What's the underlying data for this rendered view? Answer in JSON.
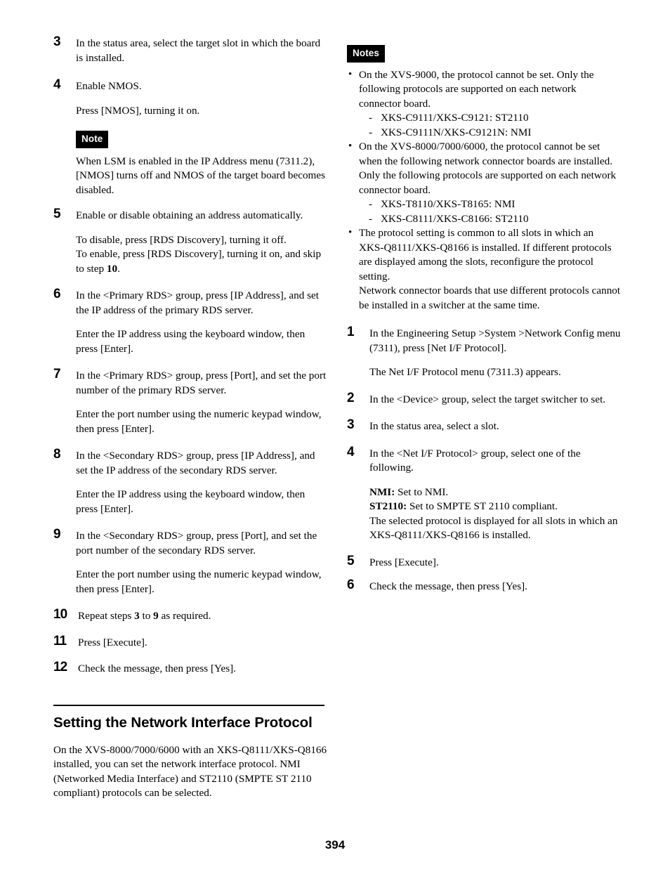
{
  "page": {
    "number": "394"
  },
  "left_column": {
    "steps": [
      {
        "num": "3",
        "paragraphs": [
          "In the status area, select the target slot in which the board is installed."
        ]
      },
      {
        "num": "4",
        "paragraphs": [
          "Enable NMOS.",
          "Press [NMOS], turning it on."
        ]
      }
    ],
    "note": {
      "badge": "Note",
      "text": "When LSM is enabled in the IP Address menu (7311.2), [NMOS] turns off and NMOS of the target board becomes disabled."
    },
    "steps_after_note": [
      {
        "num": "5",
        "paragraphs": [
          "Enable or disable obtaining an address automatically.",
          "To disable, press [RDS Discovery], turning it off."
        ],
        "extra_line_pre": "To enable, press [RDS Discovery], turning it on, and skip to step ",
        "extra_line_bold": "10",
        "extra_line_post": "."
      },
      {
        "num": "6",
        "paragraphs": [
          "In the <Primary RDS> group, press [IP Address], and set the IP address of the primary RDS server.",
          "Enter the IP address using the keyboard window, then press [Enter]."
        ]
      },
      {
        "num": "7",
        "paragraphs": [
          "In the <Primary RDS> group, press [Port], and set the port number of the primary RDS server.",
          "Enter the port number using the numeric keypad window, then press [Enter]."
        ]
      },
      {
        "num": "8",
        "paragraphs": [
          "In the <Secondary RDS> group, press [IP Address], and set the IP address of the secondary RDS server.",
          "Enter the IP address using the keyboard window, then press [Enter]."
        ]
      },
      {
        "num": "9",
        "paragraphs": [
          "In the <Secondary RDS> group, press [Port], and set the port number of the secondary RDS server.",
          "Enter the port number using the numeric keypad window, then press [Enter]."
        ]
      }
    ],
    "step10": {
      "num": "10",
      "text_pre": "Repeat steps ",
      "bold_a": "3",
      "text_mid": " to ",
      "bold_b": "9",
      "text_post": " as required."
    },
    "step11": {
      "num": "11",
      "text": "Press [Execute]."
    },
    "step12": {
      "num": "12",
      "text": "Check the message, then press [Yes]."
    },
    "section": {
      "title": "Setting the Network Interface Protocol",
      "intro": "On the XVS-8000/7000/6000 with an XKS-Q8111/XKS-Q8166 installed, you can set the network interface protocol. NMI (Networked Media Interface) and ST2110 (SMPTE ST 2110 compliant) protocols can be selected."
    }
  },
  "right_column": {
    "notes": {
      "badge": "Notes",
      "bullets": [
        {
          "text": "On the XVS-9000, the protocol cannot be set. Only the following protocols are supported on each network connector board.",
          "sub": [
            "XKS-C9111/XKS-C9121: ST2110",
            "XKS-C9111N/XKS-C9121N: NMI"
          ]
        },
        {
          "text": "On the XVS-8000/7000/6000, the protocol cannot be set when the following network connector boards are installed. Only the following protocols are supported on each network connector board.",
          "sub": [
            "XKS-T8110/XKS-T8165: NMI",
            "XKS-C8111/XKS-C8166: ST2110"
          ]
        },
        {
          "text": "The protocol setting is common to all slots in which an XKS-Q8111/XKS-Q8166 is installed. If different protocols are displayed among the slots, reconfigure the protocol setting.",
          "text2": "Network connector boards that use different protocols cannot be installed in a switcher at the same time.",
          "sub": []
        }
      ]
    },
    "steps": [
      {
        "num": "1",
        "paragraphs": [
          "In the Engineering Setup >System >Network Config menu (7311), press [Net I/F Protocol].",
          "The Net I/F Protocol menu (7311.3) appears."
        ]
      },
      {
        "num": "2",
        "paragraphs": [
          "In the <Device> group, select the target switcher to set."
        ]
      },
      {
        "num": "3",
        "paragraphs": [
          "In the status area, select a slot."
        ]
      }
    ],
    "step4": {
      "num": "4",
      "intro": "In the <Net I/F Protocol> group, select one of the following.",
      "nmi_label": "NMI:",
      "nmi_text": " Set to NMI.",
      "st_label": "ST2110:",
      "st_text": " Set to SMPTE ST 2110 compliant.",
      "tail": "The selected protocol is displayed for all slots in which an XKS-Q8111/XKS-Q8166 is installed."
    },
    "step5": {
      "num": "5",
      "text": "Press [Execute]."
    },
    "step6": {
      "num": "6",
      "text": "Check the message, then press [Yes]."
    }
  }
}
